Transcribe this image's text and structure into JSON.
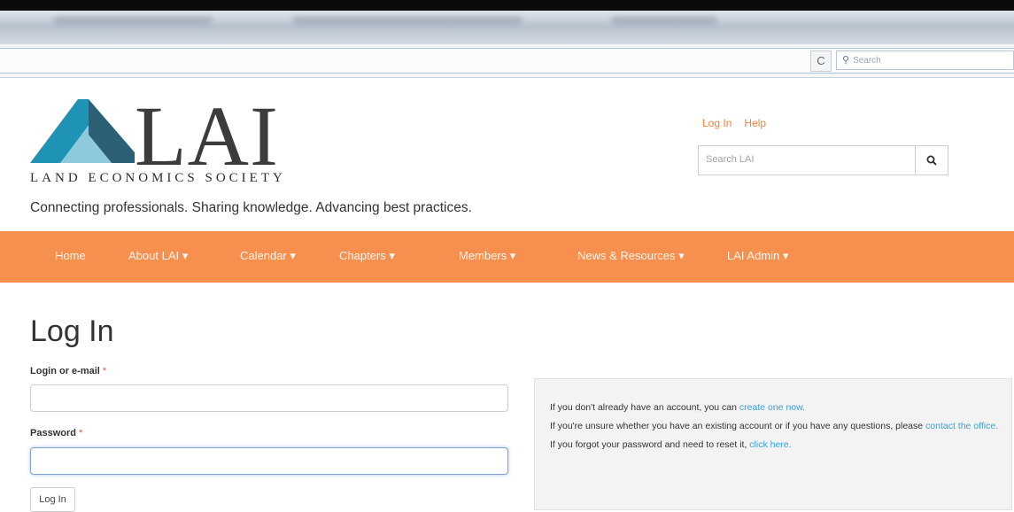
{
  "browser": {
    "reload_glyph": "C",
    "search_placeholder": "Search"
  },
  "header": {
    "logo_text": "LAI",
    "society_name": "LAND ECONOMICS SOCIETY",
    "tagline": "Connecting professionals.  Sharing knowledge.  Advancing best practices.",
    "login_link": "Log In",
    "help_link": "Help",
    "search_placeholder": "Search LAI",
    "colors": {
      "logo_teal": "#1f93b6",
      "logo_slate": "#2c6074",
      "logo_light": "#8fc9dc",
      "accent": "#f7904e",
      "link_orange": "#f0833a"
    }
  },
  "nav": {
    "items": [
      {
        "label": "Home"
      },
      {
        "label": "About LAI ▾"
      },
      {
        "label": "Calendar ▾"
      },
      {
        "label": "Chapters ▾"
      },
      {
        "label": "Members ▾"
      },
      {
        "label": "News & Resources ▾"
      },
      {
        "label": "LAI Admin ▾"
      }
    ]
  },
  "login_form": {
    "title": "Log In",
    "login_label": "Login or e-mail",
    "password_label": "Password",
    "required_mark": "*",
    "login_value": "",
    "password_value": "",
    "submit_label": "Log In"
  },
  "info": {
    "line1_prefix": "If you don't already have an account, you can ",
    "line1_link": "create one now.",
    "line2_prefix": "If you're unsure whether you have an existing account or if you have any questions, please ",
    "line2_link": "contact the office.",
    "line3_prefix": "If you forgot your password and need to reset it, ",
    "line3_link": "click here."
  }
}
